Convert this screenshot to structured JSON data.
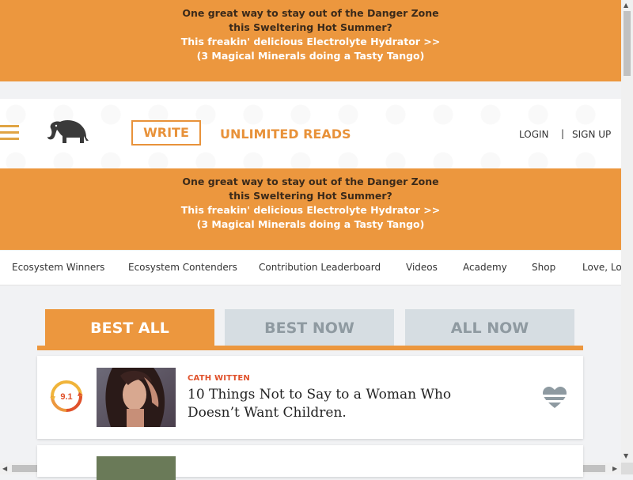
{
  "promo": {
    "line1": "One great way to stay out of the Danger Zone",
    "line2": "this Sweltering Hot Summer?",
    "line3": "This freakin' delicious Electrolyte Hydrator >>",
    "line4": "(3 Magical Minerals doing a Tasty Tango)"
  },
  "header": {
    "write_label": "WRITE",
    "unlimited_label": "UNLIMITED READS",
    "login_label": "LOGIN",
    "separator": "|",
    "signup_label": "SIGN UP"
  },
  "nav": {
    "items": [
      "Ecosystem Winners",
      "Ecosystem Contenders",
      "Contribution Leaderboard",
      "Videos",
      "Academy",
      "Shop",
      "Love, Lo"
    ]
  },
  "tabs": [
    "BEST ALL",
    "BEST NOW",
    "ALL NOW"
  ],
  "articles": [
    {
      "score": "9.1",
      "author": "CATH WITTEN",
      "title": "10 Things Not to Say to a Woman Who Doesn’t Want Children."
    }
  ],
  "colors": {
    "accent": "#ec973e",
    "author": "#e0512b",
    "tab_inactive": "#d6dde2"
  }
}
